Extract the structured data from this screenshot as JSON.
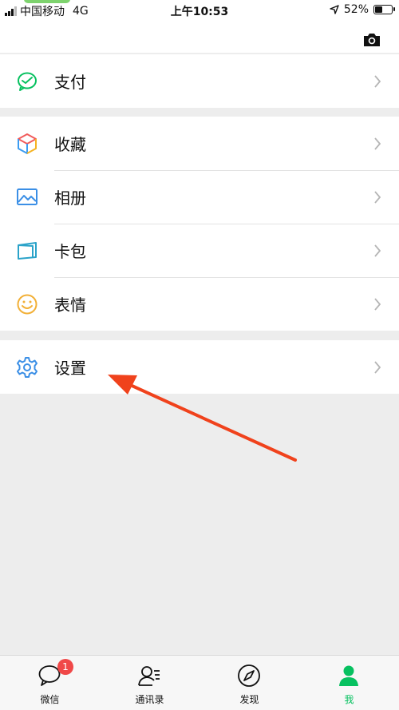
{
  "status_bar": {
    "carrier": "中国移动",
    "network": "4G",
    "time": "上午10:53",
    "battery": "52%",
    "battery_level": 0.52
  },
  "header": {
    "icon": "camera-icon"
  },
  "groups": [
    {
      "items": [
        {
          "label": "支付",
          "icon": "pay-icon"
        }
      ]
    },
    {
      "items": [
        {
          "label": "收藏",
          "icon": "favorites-cube-icon"
        },
        {
          "label": "相册",
          "icon": "album-image-icon"
        },
        {
          "label": "卡包",
          "icon": "card-wallet-icon"
        },
        {
          "label": "表情",
          "icon": "sticker-smile-icon"
        }
      ]
    },
    {
      "items": [
        {
          "label": "设置",
          "icon": "settings-gear-icon"
        }
      ]
    }
  ],
  "tabbar": {
    "tabs": [
      {
        "label": "微信",
        "icon": "chat-bubble-icon",
        "badge": "1"
      },
      {
        "label": "通讯录",
        "icon": "contacts-icon"
      },
      {
        "label": "发现",
        "icon": "discover-compass-icon"
      },
      {
        "label": "我",
        "icon": "me-person-icon",
        "active": true
      }
    ]
  },
  "colors": {
    "accent": "#07c160",
    "annotation_arrow": "#f0421c",
    "badge": "#f04848"
  }
}
